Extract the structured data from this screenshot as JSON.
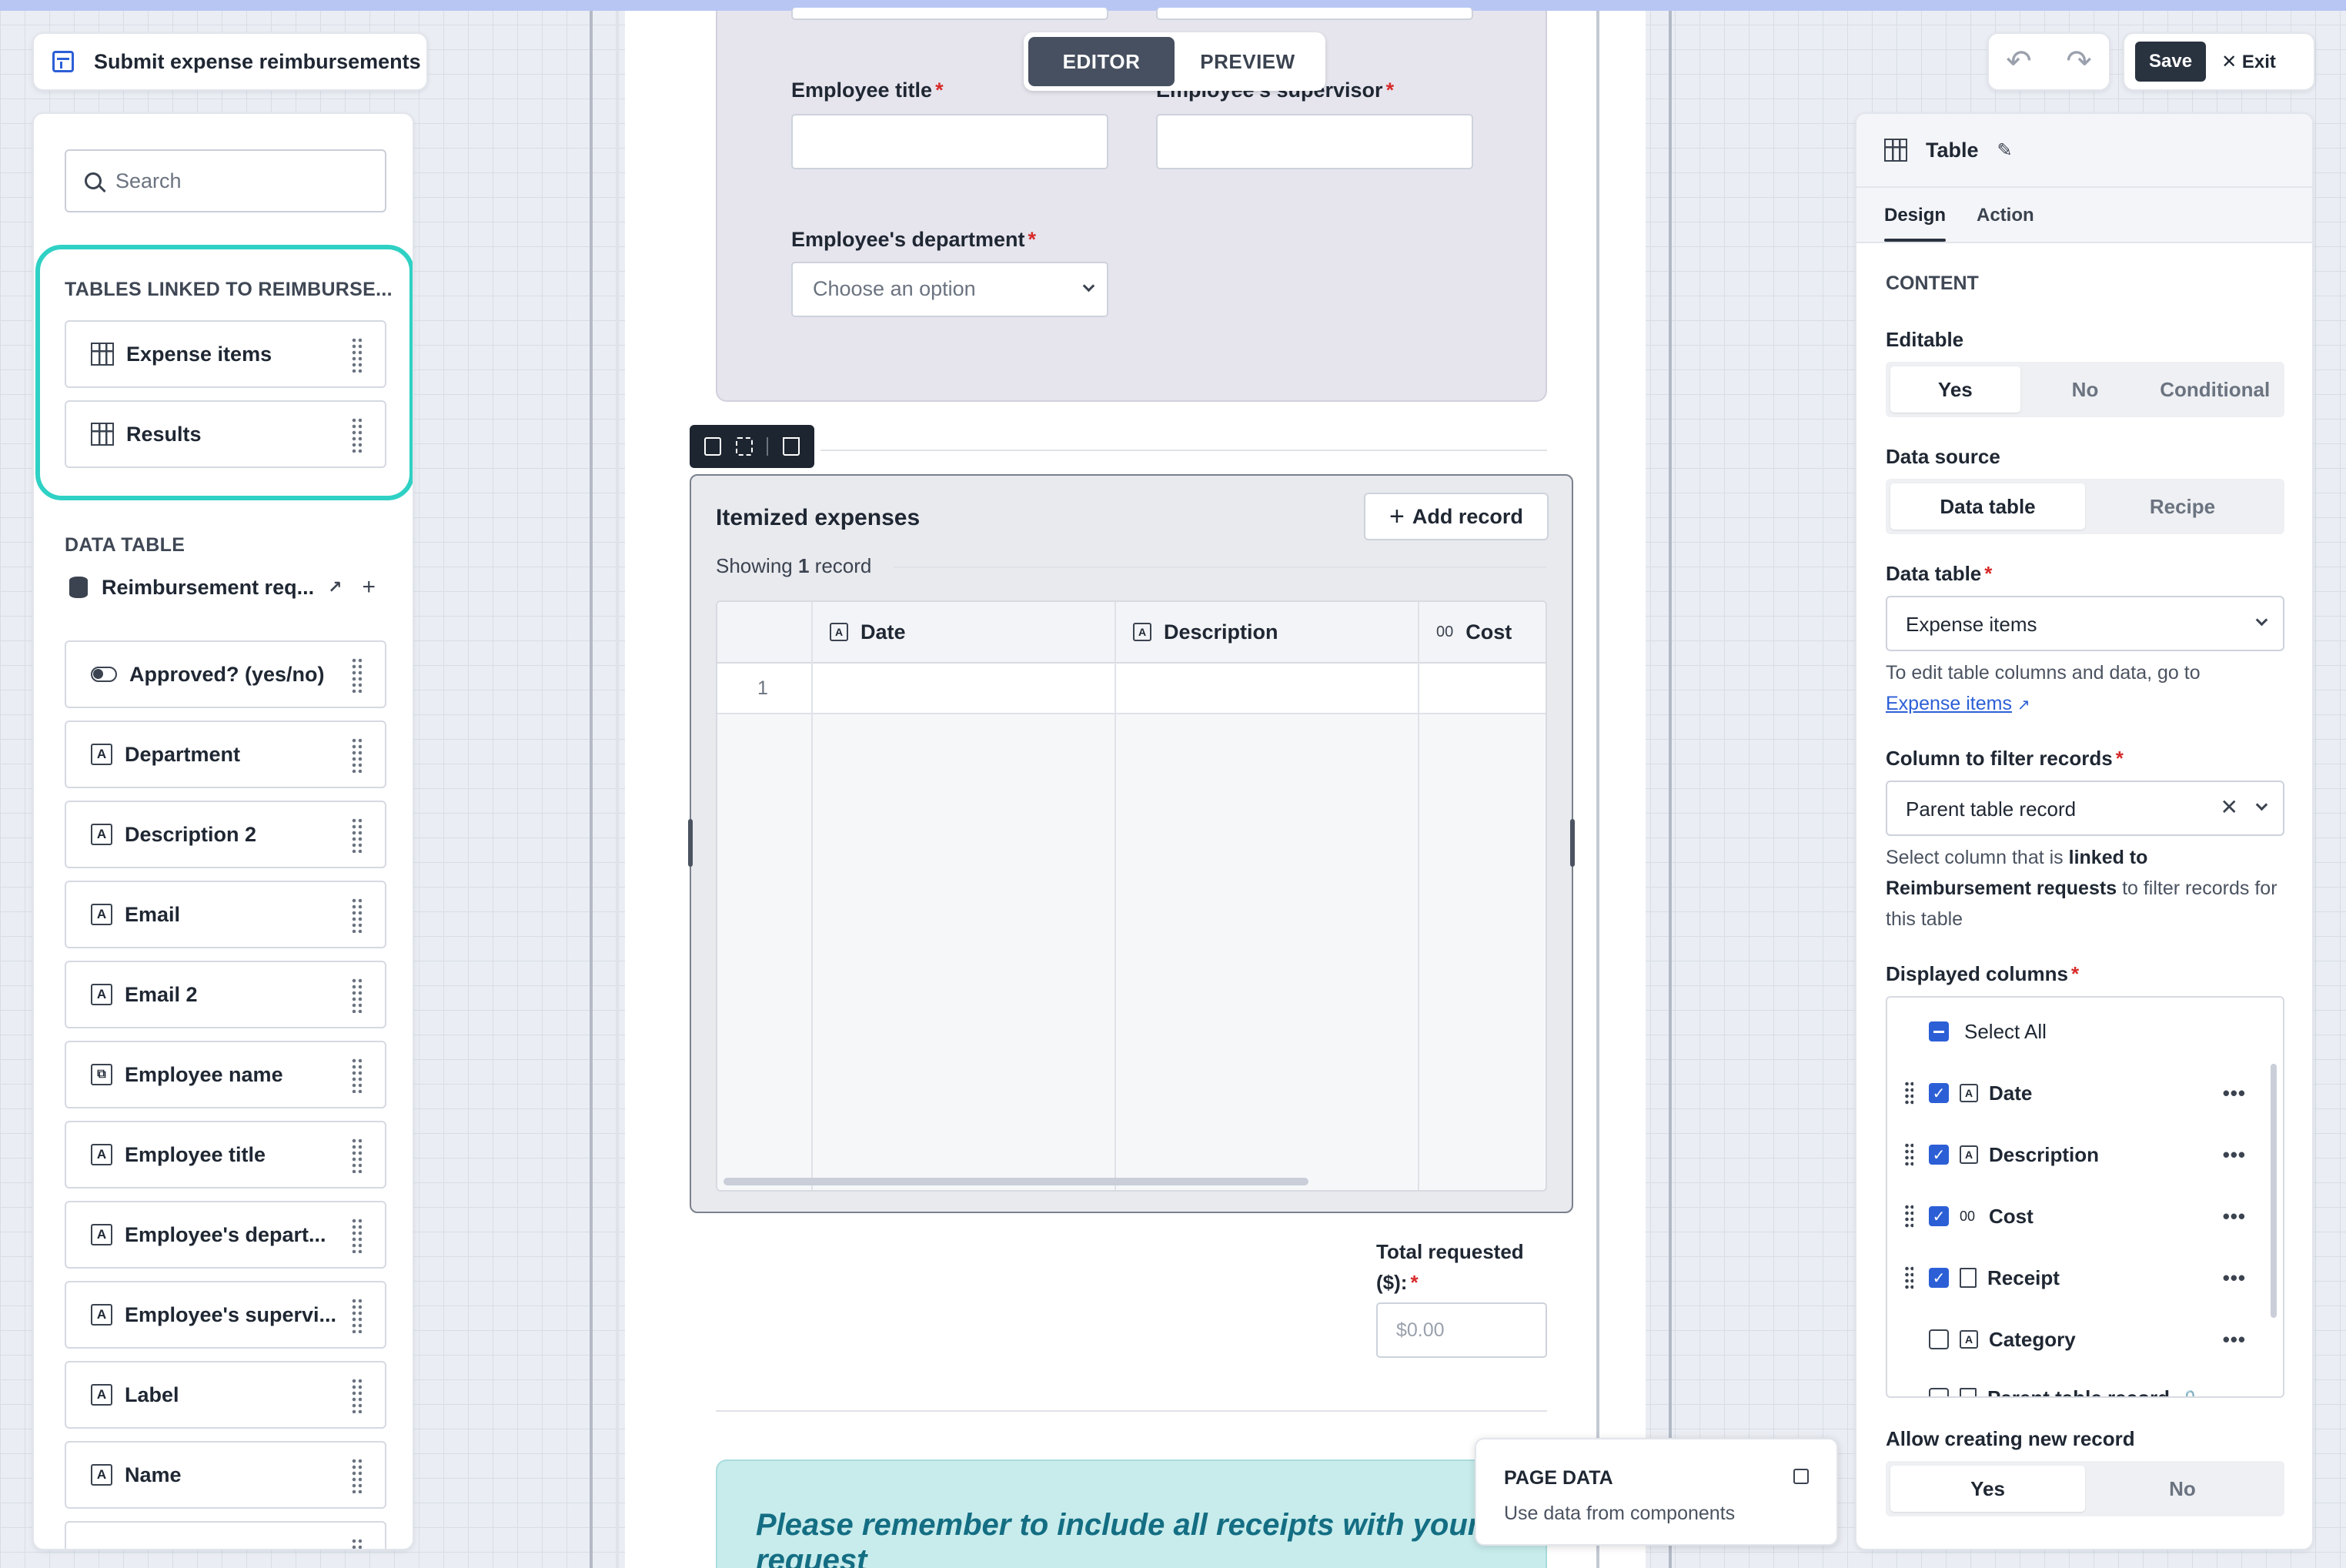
{
  "app": {
    "title": "Submit expense reimbursements"
  },
  "mode_toggle": {
    "editor": "EDITOR",
    "preview": "PREVIEW",
    "active": "editor"
  },
  "toolbar": {
    "save_label": "Save",
    "exit_label": "Exit",
    "undo_icon": "undo-icon",
    "redo_icon": "redo-icon"
  },
  "sidebar": {
    "search_placeholder": "Search",
    "linked_tables_label": "TABLES LINKED TO REIMBURSE...",
    "linked_tables": [
      {
        "label": "Expense items",
        "icon": "table-icon"
      },
      {
        "label": "Results",
        "icon": "table-icon"
      }
    ],
    "data_table_label": "DATA TABLE",
    "data_source_name": "Reimbursement req...",
    "fields": [
      {
        "label": "Approved? (yes/no)",
        "icon": "toggle-icon"
      },
      {
        "label": "Department",
        "icon": "text-field-icon"
      },
      {
        "label": "Description 2",
        "icon": "text-field-icon"
      },
      {
        "label": "Email",
        "icon": "text-field-icon"
      },
      {
        "label": "Email 2",
        "icon": "text-field-icon"
      },
      {
        "label": "Employee name",
        "icon": "link-field-icon"
      },
      {
        "label": "Employee title",
        "icon": "text-field-icon"
      },
      {
        "label": "Employee's depart...",
        "icon": "text-field-icon"
      },
      {
        "label": "Employee's supervi...",
        "icon": "text-field-icon"
      },
      {
        "label": "Label",
        "icon": "text-field-icon"
      },
      {
        "label": "Name",
        "icon": "text-field-icon"
      }
    ]
  },
  "form": {
    "employee_title_label": "Employee title",
    "supervisor_label": "Employee's supervisor",
    "department_label": "Employee's department",
    "department_placeholder": "Choose an option",
    "required_mark": "*"
  },
  "table_component": {
    "title": "Itemized expenses",
    "add_record_label": "Add record",
    "showing_prefix": "Showing",
    "showing_count": "1",
    "showing_suffix": "record",
    "columns": [
      {
        "label": "Date",
        "icon_text": "A"
      },
      {
        "label": "Description",
        "icon_text": "A"
      },
      {
        "label": "Cost",
        "icon_text": "00"
      }
    ],
    "rows": [
      {
        "index": "1"
      }
    ]
  },
  "total": {
    "label": "Total requested ($):",
    "placeholder": "$0.00"
  },
  "banner": {
    "text": "Please remember to include all receipts with your request"
  },
  "page_data": {
    "title": "PAGE DATA",
    "subtitle": "Use data from components"
  },
  "right_panel": {
    "title": "Table",
    "tabs": [
      "Design",
      "Action"
    ],
    "content_label": "CONTENT",
    "editable_label": "Editable",
    "editable_options": [
      "Yes",
      "No",
      "Conditional"
    ],
    "editable_selected": "Yes",
    "data_source_label": "Data source",
    "data_source_options": [
      "Data table",
      "Recipe"
    ],
    "data_table_label": "Data table",
    "data_table_value": "Expense items",
    "edit_help": "To edit table columns and data, go to",
    "edit_help_link": "Expense items",
    "filter_label": "Column to filter records",
    "filter_value": "Parent table record",
    "filter_help_1": "Select column that is",
    "filter_help_bold_1": "linked to",
    "filter_help_bold_2": "Reimbursement requests",
    "filter_help_2": "to filter records for this table",
    "displayed_columns_label": "Displayed columns",
    "select_all_label": "Select All",
    "displayed_columns": [
      {
        "label": "Date",
        "checked": true,
        "icon_text": "A"
      },
      {
        "label": "Description",
        "checked": true,
        "icon_text": "A"
      },
      {
        "label": "Cost",
        "checked": true,
        "icon_text": "00"
      },
      {
        "label": "Receipt",
        "checked": true,
        "icon_text": "doc"
      },
      {
        "label": "Category",
        "checked": false,
        "icon_text": "A"
      },
      {
        "label": "Parent table record",
        "checked": false,
        "icon_text": "doc"
      }
    ],
    "allow_new_label": "Allow creating new record",
    "allow_new_options": [
      "Yes",
      "No"
    ]
  },
  "colors": {
    "accent_teal": "#2fd1c4",
    "primary_blue": "#2c5fd6",
    "dark": "#29323f",
    "required_red": "#d82a2a"
  }
}
